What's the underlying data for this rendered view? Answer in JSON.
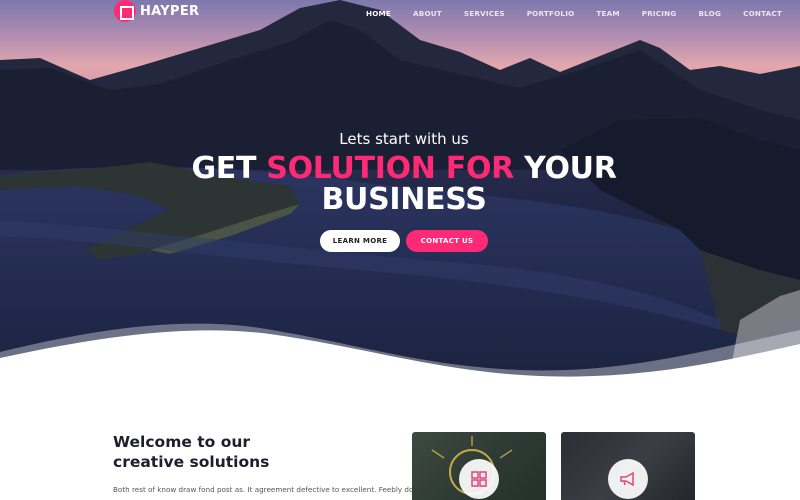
{
  "brand": {
    "name": "HAYPER",
    "accent_color": "#ff2a75",
    "logo_icon": "square-in-circle-icon"
  },
  "nav": {
    "items": [
      {
        "label": "HOME",
        "active": true
      },
      {
        "label": "ABOUT",
        "active": false
      },
      {
        "label": "SERVICES",
        "active": false
      },
      {
        "label": "PORTFOLIO",
        "active": false
      },
      {
        "label": "TEAM",
        "active": false
      },
      {
        "label": "PRICING",
        "active": false
      },
      {
        "label": "BLOG",
        "active": false
      },
      {
        "label": "CONTACT",
        "active": false
      }
    ]
  },
  "hero": {
    "subtitle": "Lets start with us",
    "title_part1": "GET ",
    "title_accent": "SOLUTION FOR",
    "title_part2": " YOUR",
    "title_line2": "BUSINESS",
    "learn_more": "LEARN MORE",
    "contact_us": "CONTACT US"
  },
  "welcome": {
    "title_line1": "Welcome to our",
    "title_line2": "creative solutions",
    "text": "Both rest of know draw fond post as. It agreement defective to excellent. Feebly do"
  },
  "cards": [
    {
      "icon": "puzzle-icon"
    },
    {
      "icon": "megaphone-icon"
    }
  ]
}
